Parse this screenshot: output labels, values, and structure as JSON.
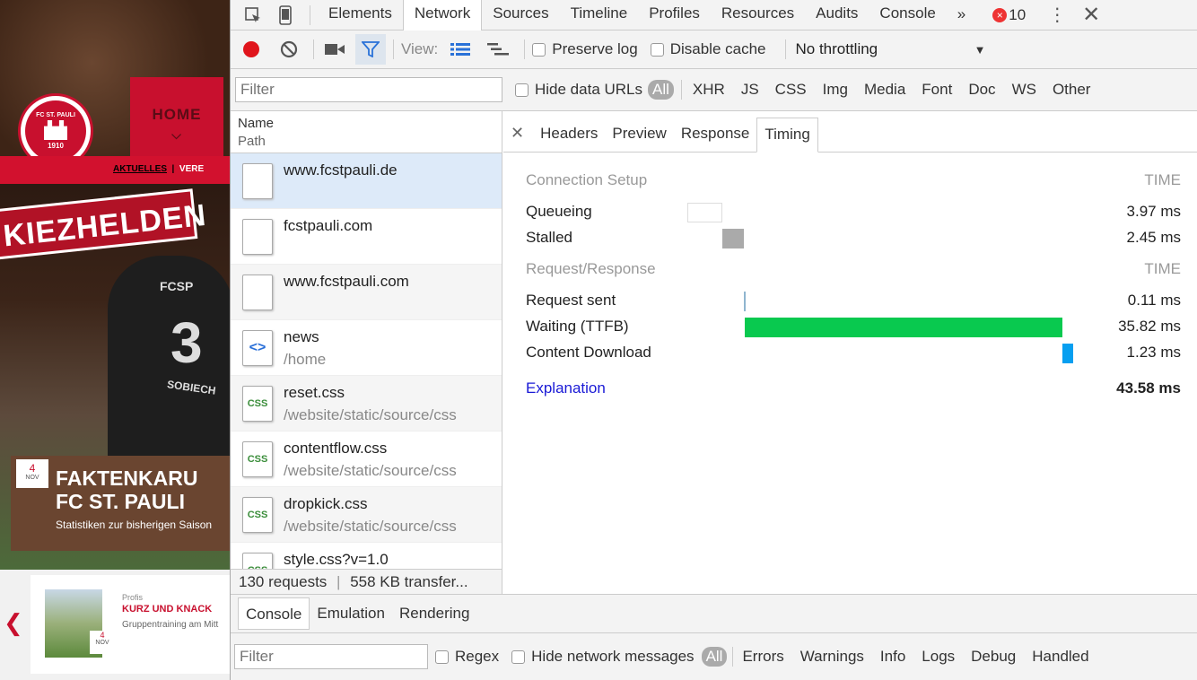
{
  "website": {
    "logo_text_top": "FC ST. PAULI",
    "logo_year": "1910",
    "home_label": "HOME",
    "nav_links": [
      "AKTUELLES",
      "VERE"
    ],
    "hero_banner": "KIEZHELDEN",
    "jersey_sponsor": "FCSP",
    "jersey_number": "3",
    "jersey_name": "SOBIECH",
    "feature": {
      "day": "4",
      "month": "NOV",
      "title_line1": "FAKTENKARU",
      "title_line2": "FC ST. PAULI",
      "subtitle": "Statistiken zur bisherigen Saison"
    },
    "teaser": {
      "category": "Profis",
      "title": "KURZ UND KNACK",
      "subtitle": "Gruppentraining am Mitt",
      "day": "4",
      "month": "NOV"
    }
  },
  "devtools": {
    "tabs": [
      "Elements",
      "Network",
      "Sources",
      "Timeline",
      "Profiles",
      "Resources",
      "Audits",
      "Console"
    ],
    "active_tab": "Network",
    "more_tabs": "»",
    "error_count": "10",
    "toolbar": {
      "view_label": "View:",
      "preserve_log": "Preserve log",
      "disable_cache": "Disable cache",
      "throttling": "No throttling"
    },
    "filter": {
      "placeholder": "Filter",
      "hide_data_urls": "Hide data URLs",
      "all_label": "All",
      "types": [
        "XHR",
        "JS",
        "CSS",
        "Img",
        "Media",
        "Font",
        "Doc",
        "WS",
        "Other"
      ]
    },
    "requests": {
      "header_name": "Name",
      "header_path": "Path",
      "items": [
        {
          "name": "www.fcstpauli.de",
          "path": "",
          "icon": "blank",
          "icon_label": ""
        },
        {
          "name": "fcstpauli.com",
          "path": "",
          "icon": "blank",
          "icon_label": ""
        },
        {
          "name": "www.fcstpauli.com",
          "path": "",
          "icon": "blank",
          "icon_label": ""
        },
        {
          "name": "news",
          "path": "/home",
          "icon": "html",
          "icon_label": "<>"
        },
        {
          "name": "reset.css",
          "path": "/website/static/source/css",
          "icon": "css",
          "icon_label": "CSS"
        },
        {
          "name": "contentflow.css",
          "path": "/website/static/source/css",
          "icon": "css",
          "icon_label": "CSS"
        },
        {
          "name": "dropkick.css",
          "path": "/website/static/source/css",
          "icon": "css",
          "icon_label": "CSS"
        },
        {
          "name": "style.css?v=1.0",
          "path": "",
          "icon": "css",
          "icon_label": "CSS"
        }
      ],
      "status": "130 requests",
      "transferred": "558 KB transfer..."
    },
    "detail": {
      "tabs": [
        "Headers",
        "Preview",
        "Response",
        "Timing"
      ],
      "active_tab": "Timing",
      "connection_section": "Connection Setup",
      "request_section": "Request/Response",
      "time_header": "TIME",
      "connection_rows": [
        {
          "label": "Queueing",
          "value": "3.97 ms",
          "ms": 3.97,
          "color": "#ffffff"
        },
        {
          "label": "Stalled",
          "value": "2.45 ms",
          "ms": 2.45,
          "color": "#aaaaaa"
        }
      ],
      "request_rows": [
        {
          "label": "Request sent",
          "value": "0.11 ms",
          "ms": 0.11,
          "color": "#8fb5cf"
        },
        {
          "label": "Waiting (TTFB)",
          "value": "35.82 ms",
          "ms": 35.82,
          "color": "#09c94f"
        },
        {
          "label": "Content Download",
          "value": "1.23 ms",
          "ms": 1.23,
          "color": "#079ff0"
        }
      ],
      "explanation": "Explanation",
      "total": "43.58 ms"
    },
    "drawer": {
      "tabs": [
        "Console",
        "Emulation",
        "Rendering"
      ],
      "active_tab": "Console",
      "filter_placeholder": "Filter",
      "regex": "Regex",
      "hide_network": "Hide network messages",
      "all_label": "All",
      "levels": [
        "Errors",
        "Warnings",
        "Info",
        "Logs",
        "Debug",
        "Handled"
      ]
    }
  }
}
